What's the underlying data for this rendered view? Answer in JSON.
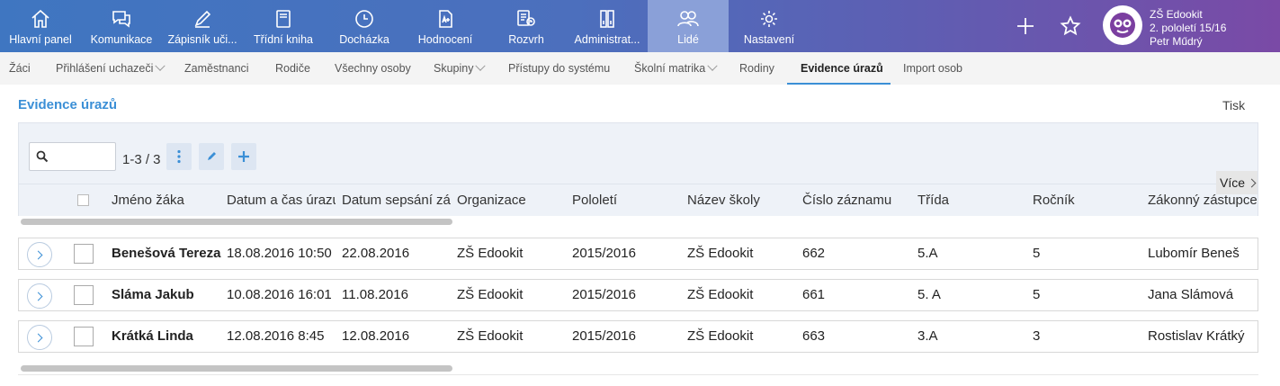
{
  "topnav": {
    "items": [
      {
        "label": "Hlavní panel",
        "icon": "home-icon"
      },
      {
        "label": "Komunikace",
        "icon": "chat-icon"
      },
      {
        "label": "Zápisník uči...",
        "icon": "pen-icon"
      },
      {
        "label": "Třídní kniha",
        "icon": "book-icon"
      },
      {
        "label": "Docházka",
        "icon": "clock-icon"
      },
      {
        "label": "Hodnocení",
        "icon": "grade-document-icon"
      },
      {
        "label": "Rozvrh",
        "icon": "schedule-icon"
      },
      {
        "label": "Administrat...",
        "icon": "binders-icon"
      },
      {
        "label": "Lidé",
        "icon": "people-icon",
        "active": true
      },
      {
        "label": "Nastavení",
        "icon": "gear-icon"
      }
    ],
    "add_icon": "plus-icon",
    "favorites_icon": "star-icon",
    "user": {
      "school": "ZŠ Edookit",
      "term": "2. pololetí 15/16",
      "name": "Petr Műdrý"
    }
  },
  "subnav": {
    "items": [
      {
        "label": "Žáci"
      },
      {
        "label": "Přihlášení uchazeči",
        "dropdown": true
      },
      {
        "label": "Zaměstnanci"
      },
      {
        "label": "Rodiče"
      },
      {
        "label": "Všechny osoby"
      },
      {
        "label": "Skupiny",
        "dropdown": true
      },
      {
        "label": "Přístupy do systému"
      },
      {
        "label": "Školní matrika",
        "dropdown": true
      },
      {
        "label": "Rodiny"
      },
      {
        "label": "Evidence úrazů",
        "active": true
      },
      {
        "label": "Import osob"
      }
    ]
  },
  "page": {
    "title": "Evidence úrazů",
    "print_label": "Tisk"
  },
  "grid": {
    "search_value": "",
    "count_label": "1-3 / 3",
    "more_label": "Více",
    "accent_color": "#3b8fd6",
    "columns": [
      "Jméno žáka",
      "Datum a čas úrazu",
      "Datum sepsání záznamu",
      "Organizace",
      "Pololetí",
      "Název školy",
      "Číslo záznamu",
      "Třída",
      "Ročník",
      "Zákonný zástupce"
    ],
    "rows": [
      {
        "name": "Benešová Tereza",
        "injury_datetime": "18.08.2016 10:50",
        "record_date": "22.08.2016",
        "organization": "ZŠ Edookit",
        "term": "2015/2016",
        "school": "ZŠ Edookit",
        "record_no": "662",
        "class": "5.A",
        "grade": "5",
        "guardian": "Lubomír Beneš"
      },
      {
        "name": "Sláma Jakub",
        "injury_datetime": "10.08.2016 16:01",
        "record_date": "11.08.2016",
        "organization": "ZŠ Edookit",
        "term": "2015/2016",
        "school": "ZŠ Edookit",
        "record_no": "661",
        "class": "5. A",
        "grade": "5",
        "guardian": "Jana Slámová"
      },
      {
        "name": "Krátká Linda",
        "injury_datetime": "12.08.2016 8:45",
        "record_date": "12.08.2016",
        "organization": "ZŠ Edookit",
        "term": "2015/2016",
        "school": "ZŠ Edookit",
        "record_no": "663",
        "class": "3.A",
        "grade": "3",
        "guardian": "Rostislav Krátký"
      }
    ]
  }
}
